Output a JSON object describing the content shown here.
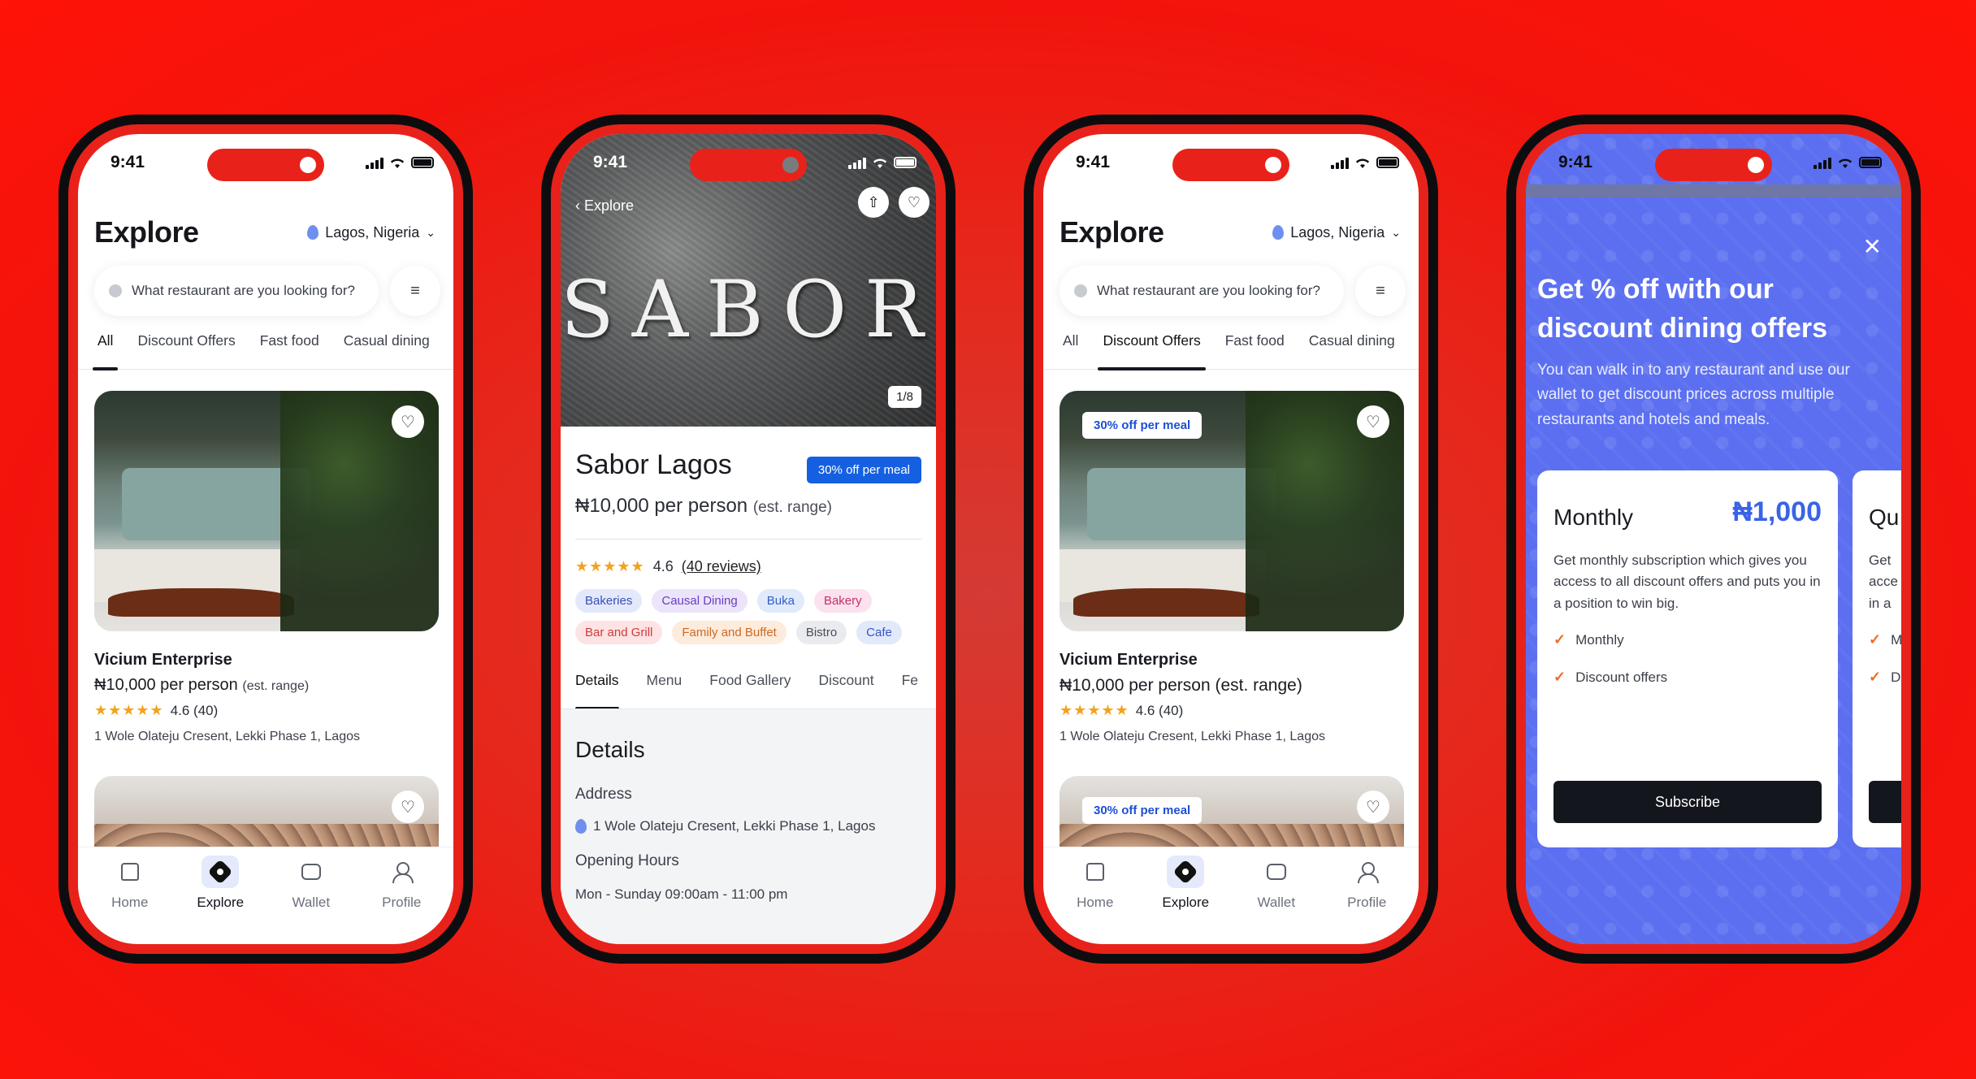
{
  "status_time": "9:41",
  "explore": {
    "title": "Explore",
    "location": "Lagos, Nigeria",
    "search_placeholder": "What restaurant are you looking for?",
    "tabs": [
      "All",
      "Discount Offers",
      "Fast food",
      "Casual dining"
    ],
    "card": {
      "name": "Vicium Enterprise",
      "price": "₦10,000 per person",
      "price_note": "(est. range)",
      "price_full": "₦10,000 per person (est. range)",
      "rating": "4.6 (40)",
      "address": "1 Wole Olateju Cresent, Lekki Phase 1, Lagos"
    },
    "discount_badge": "30% off per meal",
    "nav": [
      "Home",
      "Explore",
      "Wallet",
      "Profile"
    ]
  },
  "detail": {
    "back_label": "Explore",
    "hero_sign": "SABOR",
    "pager": "1/8",
    "name": "Sabor Lagos",
    "badge": "30% off per meal",
    "price": "₦10,000 per person",
    "price_note": "(est. range)",
    "rating": "4.6",
    "reviews": "(40 reviews)",
    "chips": [
      {
        "label": "Bakeries",
        "bg": "#e3e9fb",
        "fg": "#3850b8"
      },
      {
        "label": "Causal Dining",
        "bg": "#ece4fb",
        "fg": "#6a3fc0"
      },
      {
        "label": "Buka",
        "bg": "#e0eafb",
        "fg": "#2f5fc4"
      },
      {
        "label": "Bakery",
        "bg": "#fbe2ee",
        "fg": "#c0306f"
      },
      {
        "label": "Bar and Grill",
        "bg": "#fde3e3",
        "fg": "#cf3b3b"
      },
      {
        "label": "Family and Buffet",
        "bg": "#fdebdc",
        "fg": "#cc6a24"
      },
      {
        "label": "Bistro",
        "bg": "#e9ebef",
        "fg": "#4a4e58"
      },
      {
        "label": "Cafe",
        "bg": "#e2e9fb",
        "fg": "#3656c2"
      }
    ],
    "tabs": [
      "Details",
      "Menu",
      "Food Gallery",
      "Discount",
      "Fe"
    ],
    "section_title": "Details",
    "address_label": "Address",
    "address": "1 Wole Olateju Cresent, Lekki Phase 1, Lagos",
    "hours_label": "Opening Hours",
    "hours": "Mon - Sunday 09:00am - 11:00 pm"
  },
  "promo": {
    "title": "Get % off with our discount dining offers",
    "description": "You can walk in to any restaurant and use our wallet to get discount prices across multiple restaurants and hotels and meals.",
    "plan": {
      "name": "Monthly",
      "price": "₦1,000",
      "description": "Get monthly subscription which gives you access to all discount offers and puts you in a position to win big.",
      "features": [
        "Monthly",
        "Discount offers"
      ],
      "button": "Subscribe"
    },
    "plan2_name": "Qu",
    "plan2_desc": [
      "Get",
      "acce",
      "in a"
    ],
    "plan2_features": [
      "M",
      "D"
    ]
  },
  "colors": {
    "accent": "#1560e0",
    "promo_bg": "#5b6ff0",
    "background": "#f2140c"
  }
}
